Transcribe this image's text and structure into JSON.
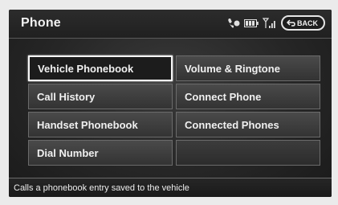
{
  "header": {
    "title": "Phone",
    "back_label": "BACK",
    "icons": [
      "bluetooth-phone-icon",
      "battery-icon",
      "signal-strength-icon",
      "back-arrow-icon"
    ]
  },
  "menu": {
    "items": [
      {
        "label": "Vehicle Phonebook",
        "selected": true
      },
      {
        "label": "Volume & Ringtone"
      },
      {
        "label": "Call History"
      },
      {
        "label": "Connect Phone"
      },
      {
        "label": "Handset Phonebook"
      },
      {
        "label": "Connected Phones"
      },
      {
        "label": "Dial Number"
      },
      {
        "label": ""
      }
    ]
  },
  "footer": {
    "help_text": "Calls a phonebook entry saved to the vehicle"
  },
  "colors": {
    "screen_bg": "#262626",
    "selected_border": "#f5f5f5",
    "button_border": "#6b6b6b",
    "text": "#f0f0f0"
  }
}
